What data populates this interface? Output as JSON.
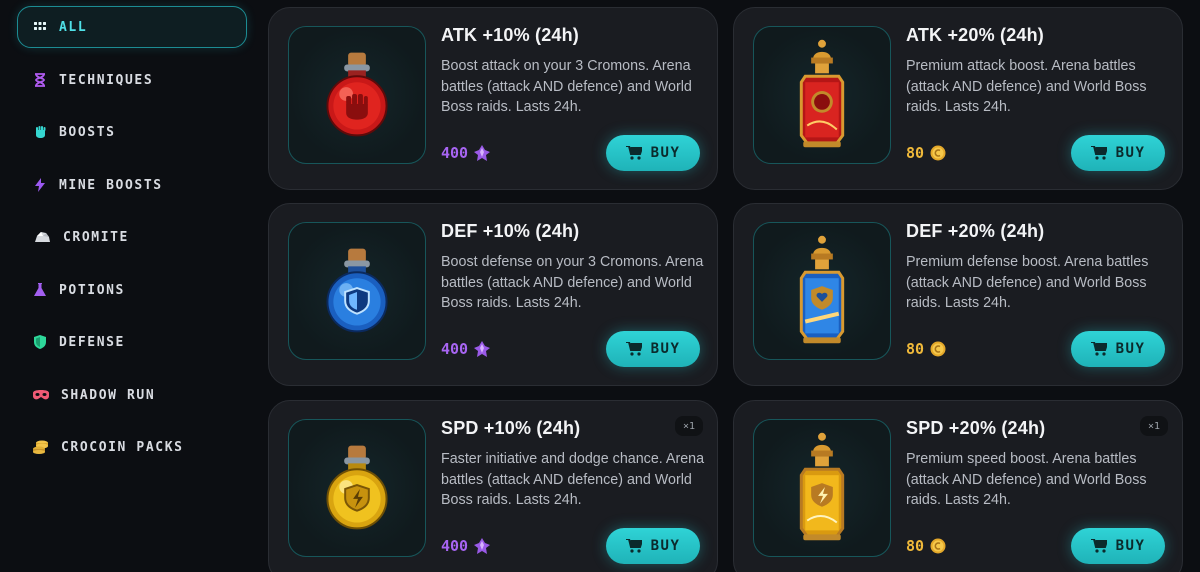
{
  "sidebar": {
    "items": [
      {
        "label": "ALL",
        "icon": "grid-icon",
        "active": true
      },
      {
        "label": "TECHNIQUES",
        "icon": "hourglass-icon"
      },
      {
        "label": "BOOSTS",
        "icon": "fist-icon"
      },
      {
        "label": "MINE BOOSTS",
        "icon": "lightning-icon"
      },
      {
        "label": "CROMITE",
        "icon": "ore-icon"
      },
      {
        "label": "POTIONS",
        "icon": "flask-icon"
      },
      {
        "label": "DEFENSE",
        "icon": "shield-icon"
      },
      {
        "label": "SHADOW RUN",
        "icon": "mask-icon"
      },
      {
        "label": "CROCOIN PACKS",
        "icon": "coins-icon"
      }
    ]
  },
  "products": [
    {
      "title": "ATK +10% (24h)",
      "description": "Boost attack on your 3 Cromons. Arena battles (attack AND defence) and World Boss raids. Lasts 24h.",
      "price": "400",
      "currency": "gem",
      "buy_label": "BUY",
      "image": "red-round-potion",
      "badge": ""
    },
    {
      "title": "ATK +20% (24h)",
      "description": "Premium attack boost. Arena battles (attack AND defence) and World Boss raids. Lasts 24h.",
      "price": "80",
      "currency": "coin",
      "buy_label": "BUY",
      "image": "red-ornate-potion",
      "badge": ""
    },
    {
      "title": "DEF +10% (24h)",
      "description": "Boost defense on your 3 Cromons. Arena battles (attack AND defence) and World Boss raids. Lasts 24h.",
      "price": "400",
      "currency": "gem",
      "buy_label": "BUY",
      "image": "blue-round-potion",
      "badge": ""
    },
    {
      "title": "DEF +20% (24h)",
      "description": "Premium defense boost. Arena battles (attack AND defence) and World Boss raids. Lasts 24h.",
      "price": "80",
      "currency": "coin",
      "buy_label": "BUY",
      "image": "blue-ornate-potion",
      "badge": ""
    },
    {
      "title": "SPD +10% (24h)",
      "description": "Faster initiative and dodge chance. Arena battles (attack AND defence) and World Boss raids. Lasts 24h.",
      "price": "400",
      "currency": "gem",
      "buy_label": "BUY",
      "image": "yellow-round-potion",
      "badge": "×1"
    },
    {
      "title": "SPD +20% (24h)",
      "description": "Premium speed boost. Arena battles (attack AND defence) and World Boss raids. Lasts 24h.",
      "price": "80",
      "currency": "coin",
      "buy_label": "BUY",
      "image": "yellow-ornate-potion",
      "badge": "×1"
    }
  ],
  "colors": {
    "accent": "#2fd3d6",
    "gem": "#a865f3",
    "coin": "#f0b93a",
    "atk": "#e0241f",
    "def": "#2a7fe0",
    "spd": "#e8b81c"
  }
}
